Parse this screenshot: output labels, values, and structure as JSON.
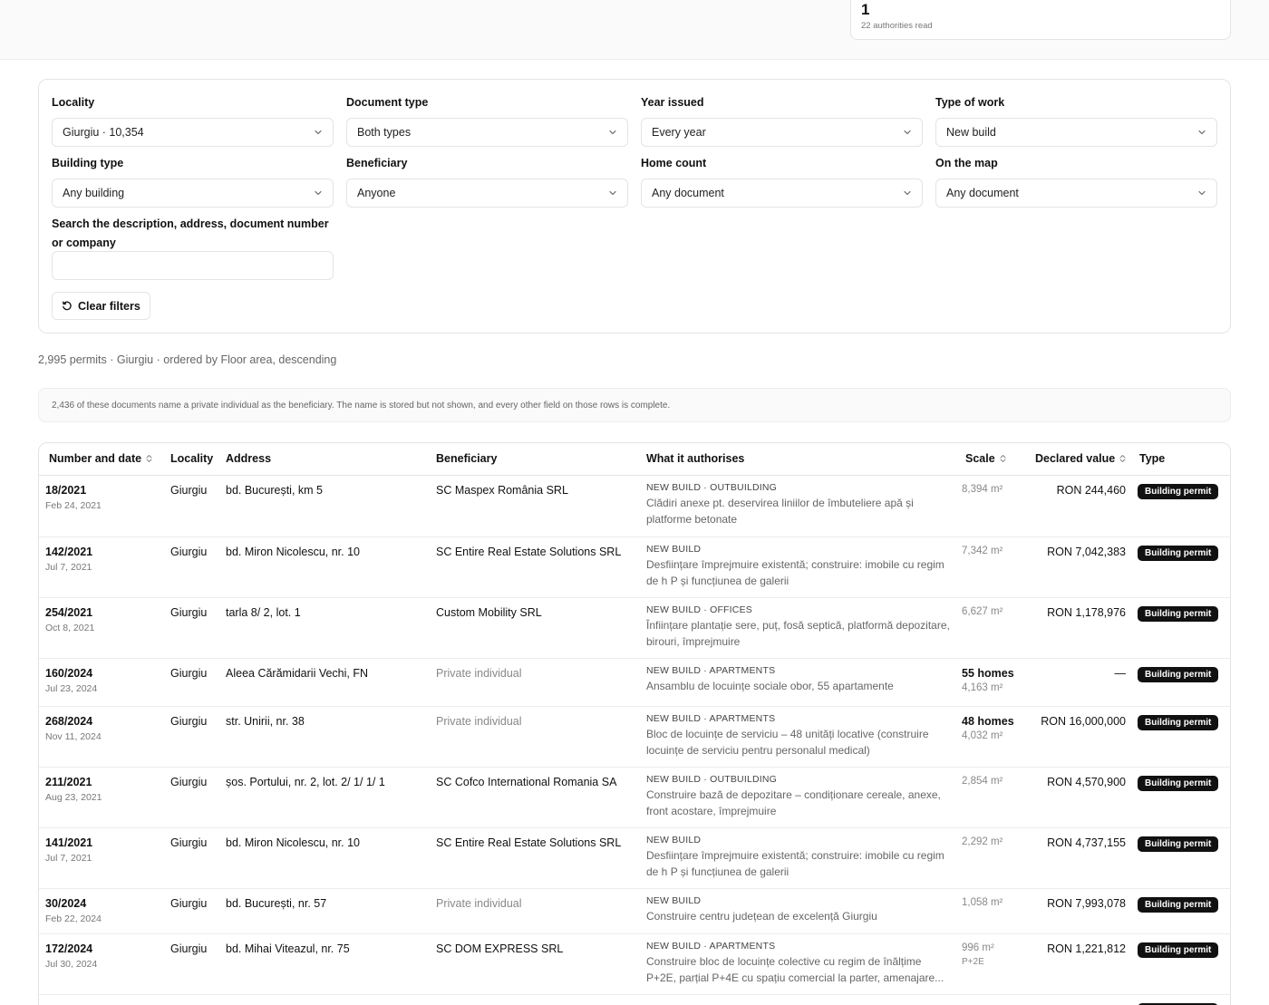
{
  "stats": {
    "value": "1",
    "label": "22 authorities read"
  },
  "filters": [
    {
      "key": "locality",
      "label": "Locality",
      "value": "Giurgiu · 10,354"
    },
    {
      "key": "document-type",
      "label": "Document type",
      "value": "Both types"
    },
    {
      "key": "year-issued",
      "label": "Year issued",
      "value": "Every year"
    },
    {
      "key": "type-of-work",
      "label": "Type of work",
      "value": "New build"
    },
    {
      "key": "building-type",
      "label": "Building type",
      "value": "Any building"
    },
    {
      "key": "beneficiary",
      "label": "Beneficiary",
      "value": "Anyone"
    },
    {
      "key": "home-count",
      "label": "Home count",
      "value": "Any document"
    },
    {
      "key": "on-the-map",
      "label": "On the map",
      "value": "Any document"
    }
  ],
  "search": {
    "label": "Search the description, address, document number or company",
    "value": ""
  },
  "clear_label": "Clear filters",
  "summary": "2,995 permits · Giurgiu · ordered by Floor area, descending",
  "notice": "2,436 of these documents name a private individual as the beneficiary. The name is stored but not shown, and every other field on those rows is complete.",
  "table": {
    "columns": [
      {
        "key": "number",
        "label": "Number and date",
        "sortable": true
      },
      {
        "key": "locality",
        "label": "Locality",
        "sortable": false
      },
      {
        "key": "address",
        "label": "Address",
        "sortable": false
      },
      {
        "key": "beneficiary",
        "label": "Beneficiary",
        "sortable": false
      },
      {
        "key": "what",
        "label": "What it authorises",
        "sortable": false
      },
      {
        "key": "scale",
        "label": "Scale",
        "sortable": true
      },
      {
        "key": "value",
        "label": "Declared value",
        "sortable": true
      },
      {
        "key": "type",
        "label": "Type",
        "sortable": false
      }
    ],
    "rows": [
      {
        "number": "18/2021",
        "date": "Feb 24, 2021",
        "locality": "Giurgiu",
        "address": "bd. București, km 5",
        "beneficiary": "SC Maspex România SRL",
        "private": false,
        "kind": "NEW BUILD · OUTBUILDING",
        "description": "Clădiri anexe pt. deservirea liniilor de îmbuteliere apă și platforme betonate",
        "homes": "",
        "area": "8,394 m²",
        "floors": "",
        "value": "RON 244,460",
        "type": "Building permit"
      },
      {
        "number": "142/2021",
        "date": "Jul 7, 2021",
        "locality": "Giurgiu",
        "address": "bd. Miron Nicolescu, nr. 10",
        "beneficiary": "SC Entire Real Estate Solutions SRL",
        "private": false,
        "kind": "NEW BUILD",
        "description": "Desființare împrejmuire existentă; construire: imobile cu regim de h P și funcțiunea de galerii",
        "homes": "",
        "area": "7,342 m²",
        "floors": "",
        "value": "RON 7,042,383",
        "type": "Building permit"
      },
      {
        "number": "254/2021",
        "date": "Oct 8, 2021",
        "locality": "Giurgiu",
        "address": "tarla 8/ 2, lot. 1",
        "beneficiary": "Custom Mobility SRL",
        "private": false,
        "kind": "NEW BUILD · OFFICES",
        "description": "Înființare plantație sere, puț, fosă septică, platformă depozitare, birouri, împrejmuire",
        "homes": "",
        "area": "6,627 m²",
        "floors": "",
        "value": "RON 1,178,976",
        "type": "Building permit"
      },
      {
        "number": "160/2024",
        "date": "Jul 23, 2024",
        "locality": "Giurgiu",
        "address": "Aleea Cărămidarii Vechi, FN",
        "beneficiary": "Private individual",
        "private": true,
        "kind": "NEW BUILD · APARTMENTS",
        "description": "Ansamblu de locuințe sociale obor, 55 apartamente",
        "homes": "55 homes",
        "area": "4,163 m²",
        "floors": "",
        "value": "—",
        "type": "Building permit"
      },
      {
        "number": "268/2024",
        "date": "Nov 11, 2024",
        "locality": "Giurgiu",
        "address": "str. Unirii, nr. 38",
        "beneficiary": "Private individual",
        "private": true,
        "kind": "NEW BUILD · APARTMENTS",
        "description": "Bloc de locuințe de serviciu – 48 unități locative (construire locuințe de serviciu pentru personalul medical)",
        "homes": "48 homes",
        "area": "4,032 m²",
        "floors": "",
        "value": "RON 16,000,000",
        "type": "Building permit"
      },
      {
        "number": "211/2021",
        "date": "Aug 23, 2021",
        "locality": "Giurgiu",
        "address": "șos. Portului, nr. 2, lot. 2/ 1/ 1/ 1",
        "beneficiary": "SC Cofco International Romania SA",
        "private": false,
        "kind": "NEW BUILD · OUTBUILDING",
        "description": "Construire bază de depozitare – condiționare cereale, anexe, front acostare, împrejmuire",
        "homes": "",
        "area": "2,854 m²",
        "floors": "",
        "value": "RON 4,570,900",
        "type": "Building permit"
      },
      {
        "number": "141/2021",
        "date": "Jul 7, 2021",
        "locality": "Giurgiu",
        "address": "bd. Miron Nicolescu, nr. 10",
        "beneficiary": "SC Entire Real Estate Solutions SRL",
        "private": false,
        "kind": "NEW BUILD",
        "description": "Desființare împrejmuire existentă; construire: imobile cu regim de h P și funcțiunea de galerii",
        "homes": "",
        "area": "2,292 m²",
        "floors": "",
        "value": "RON 4,737,155",
        "type": "Building permit"
      },
      {
        "number": "30/2024",
        "date": "Feb 22, 2024",
        "locality": "Giurgiu",
        "address": "bd. București, nr. 57",
        "beneficiary": "Private individual",
        "private": true,
        "kind": "NEW BUILD",
        "description": "Construire centru județean de excelență Giurgiu",
        "homes": "",
        "area": "1,058 m²",
        "floors": "",
        "value": "RON 7,993,078",
        "type": "Building permit"
      },
      {
        "number": "172/2024",
        "date": "Jul 30, 2024",
        "locality": "Giurgiu",
        "address": "bd. Mihai Viteazul, nr. 75",
        "beneficiary": "SC DOM EXPRESS SRL",
        "private": false,
        "kind": "NEW BUILD · APARTMENTS",
        "description": "Construire bloc de locuințe colective cu regim de înălțime P+2E, parțial P+4E cu spațiu comercial la parter, amenajare...",
        "homes": "",
        "area": "996 m²",
        "floors": "P+2E",
        "value": "RON 1,221,812",
        "type": "Building permit"
      },
      {
        "number": "",
        "date": "",
        "locality": "",
        "address": "",
        "beneficiary": "",
        "private": false,
        "kind": "",
        "description": "",
        "homes": "",
        "area": "",
        "floors": "",
        "value": "",
        "type": "Building permit"
      }
    ]
  }
}
